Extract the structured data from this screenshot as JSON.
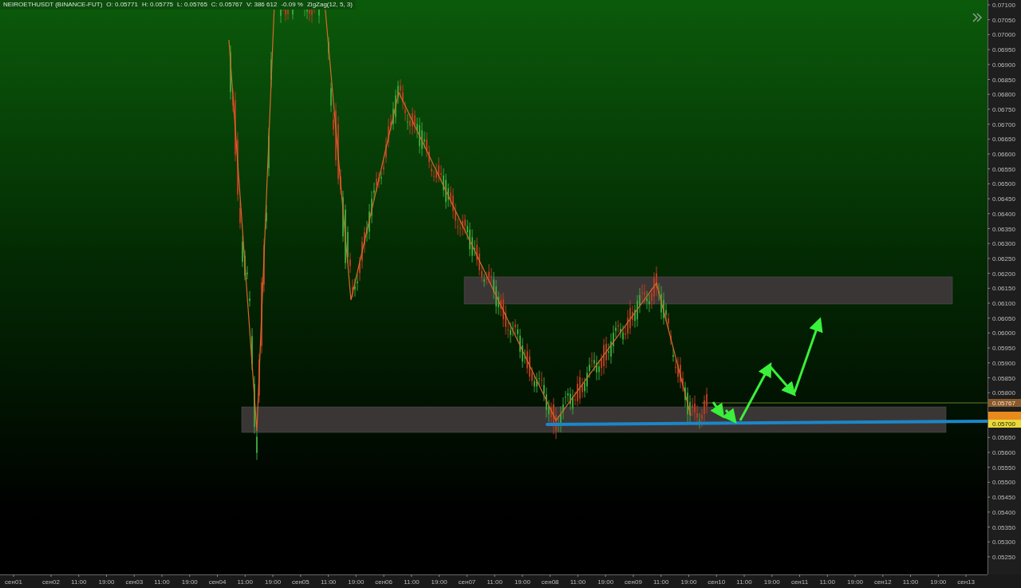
{
  "header": {
    "symbol": "NEIROETHUSDT (BINANCE-FUT)",
    "open": "O: 0.05771",
    "high": "H: 0.05775",
    "low": "L: 0.05765",
    "close": "C: 0.05767",
    "volume": "V: 386 612",
    "change": "-0.09 %",
    "indicator": "ZigZag(12, 5, 3)"
  },
  "price_axis": {
    "labels": [
      "0.07100",
      "0.07050",
      "0.07000",
      "0.06950",
      "0.06900",
      "0.06850",
      "0.06800",
      "0.06750",
      "0.06700",
      "0.06650",
      "0.06600",
      "0.06550",
      "0.06500",
      "0.06450",
      "0.06400",
      "0.06350",
      "0.06300",
      "0.06250",
      "0.06200",
      "0.06150",
      "0.06100",
      "0.06050",
      "0.06000",
      "0.05950",
      "0.05900",
      "0.05850",
      "0.05800"
    ],
    "labels_lower": [
      "0.05650",
      "0.05600",
      "0.05550",
      "0.05500",
      "0.05450",
      "0.05400",
      "0.05350",
      "0.05300",
      "0.05250"
    ],
    "tags": [
      {
        "kind": "last",
        "text": "0.05767"
      },
      {
        "kind": "alert"
      },
      {
        "kind": "level",
        "text": "0.05700"
      }
    ]
  },
  "time_axis": {
    "labels": [
      "сен01",
      "сен02",
      "11:00",
      "19:00",
      "сен03",
      "11:00",
      "19:00",
      "сен04",
      "11:00",
      "19:00",
      "сен05",
      "11:00",
      "19:00",
      "сен06",
      "11:00",
      "19:00",
      "сен07",
      "11:00",
      "19:00",
      "сен08",
      "11:00",
      "19:00",
      "сен09",
      "11:00",
      "19:00",
      "сен10",
      "11:00",
      "19:00",
      "сен11",
      "11:00",
      "19:00",
      "сен12",
      "11:00",
      "19:00",
      "сен13"
    ]
  }
}
